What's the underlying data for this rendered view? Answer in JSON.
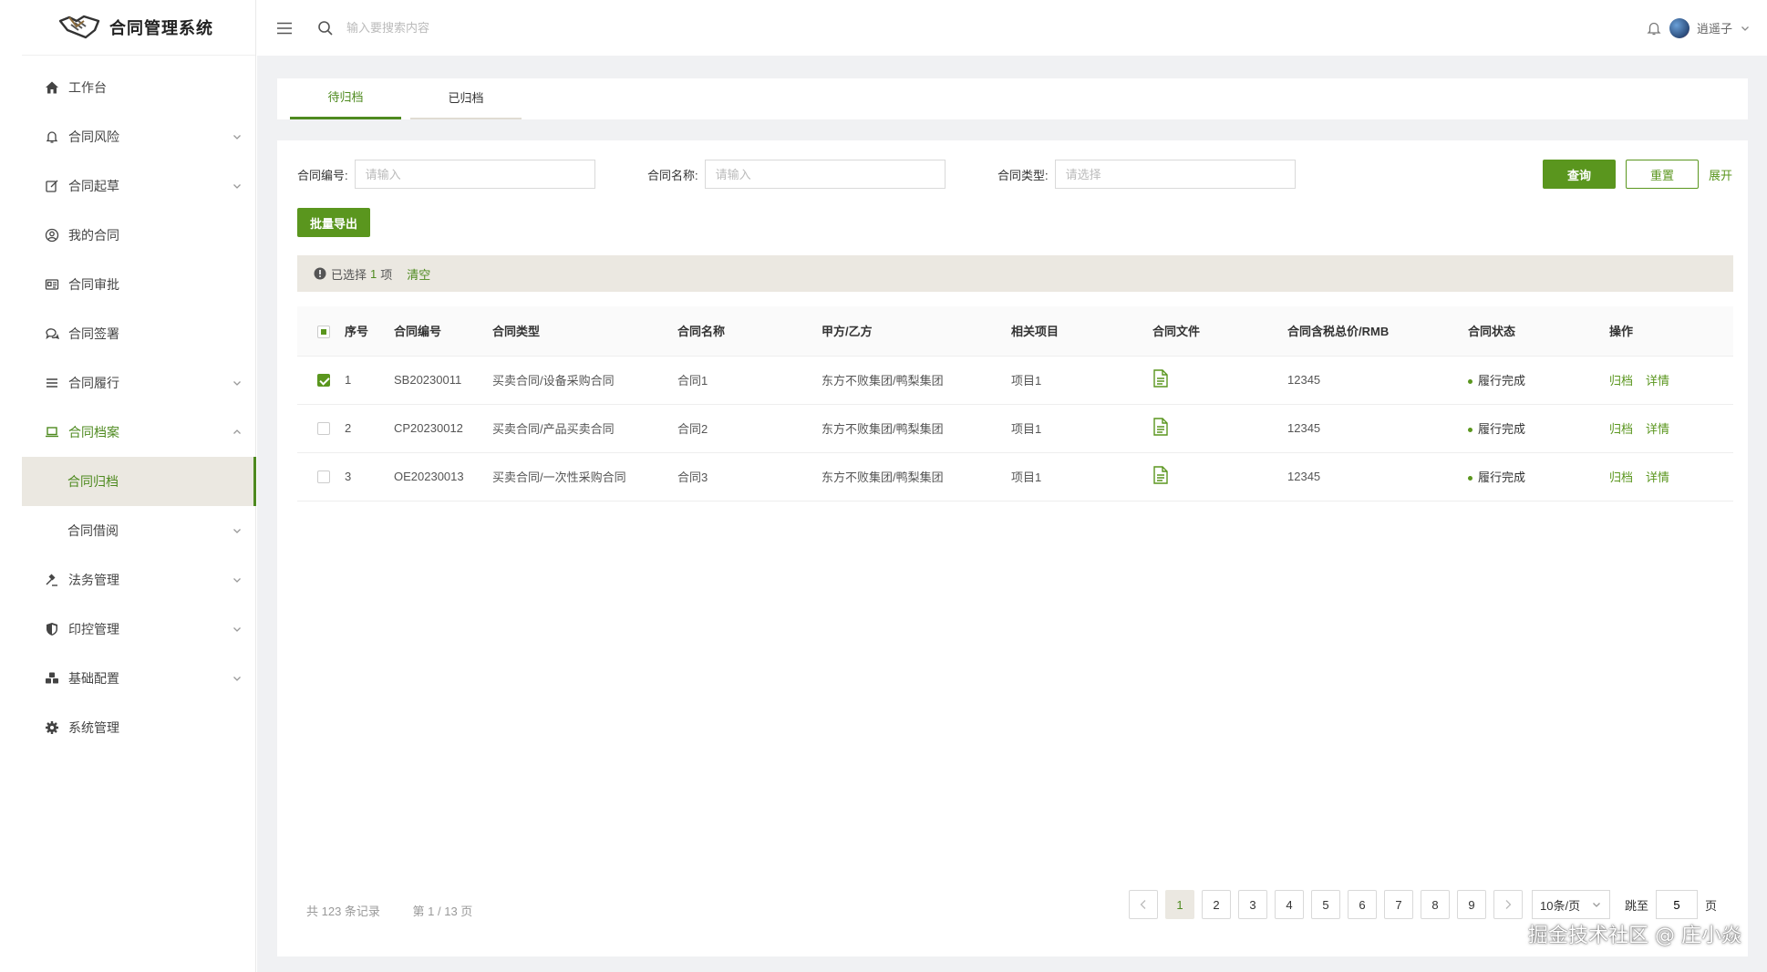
{
  "app": {
    "title": "合同管理系统"
  },
  "header": {
    "search_placeholder": "输入要搜索内容",
    "username": "逍遥子"
  },
  "sidebar": {
    "items": [
      {
        "label": "工作台"
      },
      {
        "label": "合同风险"
      },
      {
        "label": "合同起草"
      },
      {
        "label": "我的合同"
      },
      {
        "label": "合同审批"
      },
      {
        "label": "合同签署"
      },
      {
        "label": "合同履行"
      },
      {
        "label": "合同档案"
      },
      {
        "label": "合同归档"
      },
      {
        "label": "合同借阅"
      },
      {
        "label": "法务管理"
      },
      {
        "label": "印控管理"
      },
      {
        "label": "基础配置"
      },
      {
        "label": "系统管理"
      }
    ]
  },
  "tabs": [
    {
      "label": "待归档"
    },
    {
      "label": "已归档"
    }
  ],
  "filters": {
    "contract_no": {
      "label": "合同编号:",
      "placeholder": "请输入"
    },
    "contract_name": {
      "label": "合同名称:",
      "placeholder": "请输入"
    },
    "contract_type": {
      "label": "合同类型:",
      "placeholder": "请选择"
    },
    "query": "查询",
    "reset": "重置",
    "expand": "展开"
  },
  "toolbar": {
    "export": "批量导出"
  },
  "selection": {
    "prefix": "已选择",
    "count": "1",
    "suffix": "项",
    "clear": "清空"
  },
  "table": {
    "columns": [
      "序号",
      "合同编号",
      "合同类型",
      "合同名称",
      "甲方/乙方",
      "相关项目",
      "合同文件",
      "合同含税总价/RMB",
      "合同状态",
      "操作"
    ],
    "rows": [
      {
        "index": "1",
        "no": "SB20230011",
        "type": "买卖合同/设备采购合同",
        "name": "合同1",
        "party": "东方不败集团/鸭梨集团",
        "project": "项目1",
        "price": "12345",
        "status": "履行完成",
        "op_archive": "归档",
        "op_detail": "详情"
      },
      {
        "index": "2",
        "no": "CP20230012",
        "type": "买卖合同/产品买卖合同",
        "name": "合同2",
        "party": "东方不败集团/鸭梨集团",
        "project": "项目1",
        "price": "12345",
        "status": "履行完成",
        "op_archive": "归档",
        "op_detail": "详情"
      },
      {
        "index": "3",
        "no": "OE20230013",
        "type": "买卖合同/一次性采购合同",
        "name": "合同3",
        "party": "东方不败集团/鸭梨集团",
        "project": "项目1",
        "price": "12345",
        "status": "履行完成",
        "op_archive": "归档",
        "op_detail": "详情"
      }
    ]
  },
  "pagination": {
    "total": "共 123 条记录",
    "page_info": "第 1 / 13 页",
    "pages": [
      "1",
      "2",
      "3",
      "4",
      "5",
      "6",
      "7",
      "8",
      "9"
    ],
    "page_size": "10条/页",
    "jump_label": "跳至",
    "jump_value": "5",
    "jump_suffix": "页"
  },
  "watermark": "掘金技术社区 @ 庄小焱",
  "colors": {
    "accent": "#5a961e",
    "active_bg": "#ebe8e1"
  }
}
